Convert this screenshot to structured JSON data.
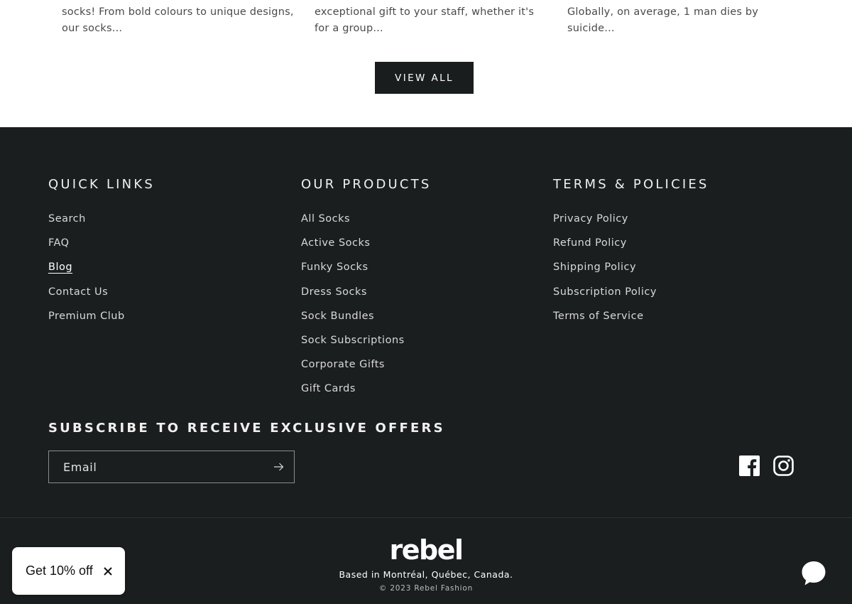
{
  "blog_excerpts": [
    {
      "text": "socks! From bold colours to unique designs, our socks..."
    },
    {
      "text": "exceptional gift to your staff, whether it's for a group..."
    },
    {
      "text": "Globally, on average, 1 man dies by suicide..."
    }
  ],
  "view_all_label": "VIEW ALL",
  "footer": {
    "quick_links": {
      "heading": "QUICK LINKS",
      "items": [
        "Search",
        "FAQ",
        "Blog",
        "Contact Us",
        "Premium Club"
      ],
      "active_item": "Blog"
    },
    "our_products": {
      "heading": "OUR PRODUCTS",
      "items": [
        "All Socks",
        "Active Socks",
        "Funky Socks",
        "Dress Socks",
        "Sock Bundles",
        "Sock Subscriptions",
        "Corporate Gifts",
        "Gift Cards"
      ]
    },
    "terms": {
      "heading": "TERMS & POLICIES",
      "items": [
        "Privacy Policy",
        "Refund Policy",
        "Shipping Policy",
        "Subscription Policy",
        "Terms of Service"
      ]
    },
    "subscribe": {
      "heading": "SUBSCRIBE TO RECEIVE EXCLUSIVE OFFERS",
      "email_placeholder": "Email",
      "submit_icon": "arrow-right-icon"
    },
    "social": [
      "facebook-icon",
      "instagram-icon"
    ],
    "brand": {
      "logo_text": "rebel",
      "location": "Based in Montréal, Québec, Canada.",
      "copyright": "© 2023 Rebel Fashion"
    }
  },
  "discount_popup": {
    "label": "Get 10% off",
    "close_icon": "close-icon"
  },
  "chat_widget": {
    "icon": "chat-bubble-icon"
  },
  "colors": {
    "footer_bg": "#1b1e1f",
    "button_bg": "#1a1d1e",
    "text_light": "#e6e6e6",
    "excerpt_text": "#4a4a4a"
  }
}
